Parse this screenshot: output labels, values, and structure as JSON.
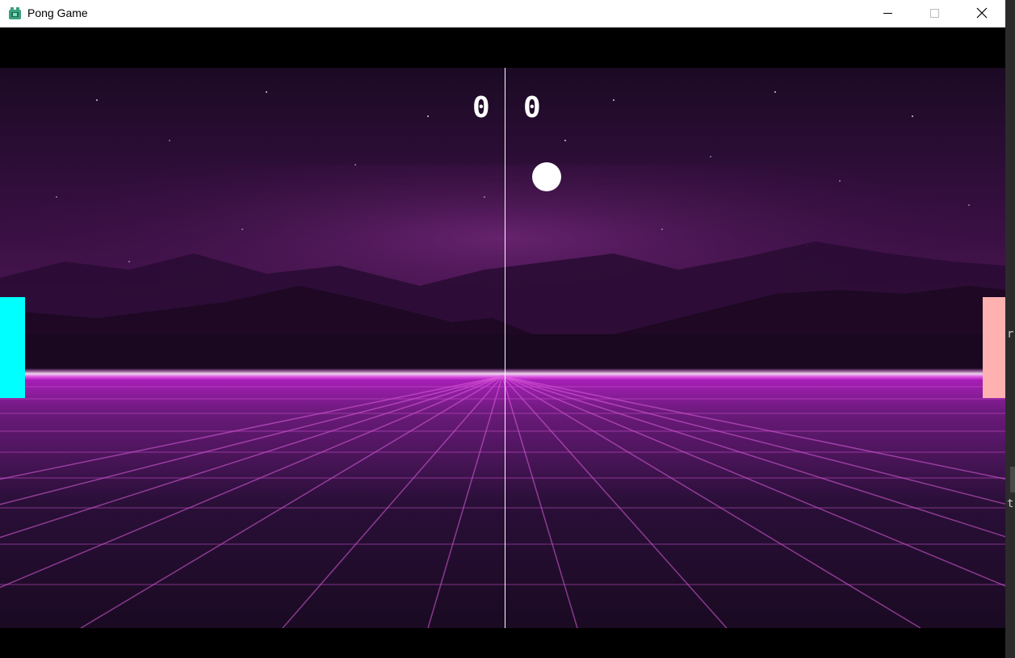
{
  "window": {
    "title": "Pong Game",
    "icon": "python-app-icon",
    "controls": [
      "minimize-icon",
      "maximize-icon",
      "close-icon"
    ]
  },
  "game": {
    "score_left": "0",
    "score_right": "0",
    "colors": {
      "left_paddle": "#00ffff",
      "right_paddle": "#ffb0b0",
      "ball": "#ffffff",
      "center_line": "#ffffff"
    },
    "background": "synthwave-grid-mountains"
  },
  "side_panel": {
    "glyph_1": "r",
    "glyph_2": "t"
  }
}
